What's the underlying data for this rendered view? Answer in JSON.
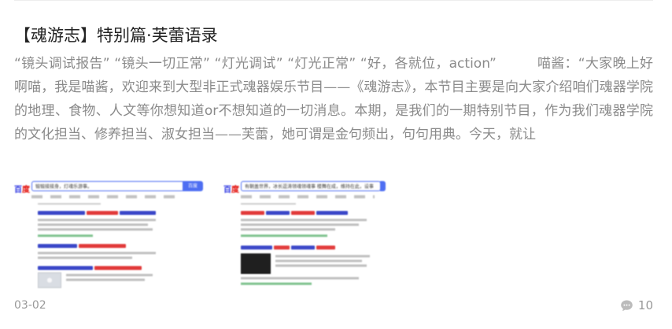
{
  "article": {
    "title": "【魂游志】特别篇·芙蕾语录",
    "summary": "“镜头调试报告” “镜头一切正常” “灯光调试” “灯光正常” “好，各就位，action”　　　喵酱：“大家晚上好啊喵，我是喵酱，欢迎来到大型非正式魂器娱乐节目——《魂游志》，本节目主要是向大家介绍咱们魂器学院的地理、食物、人文等你想知道or不想知道的一切消息。本期，是我们的一期特别节目，作为我们魂器学院的文化担当、修养担当、淑女担当——芙蕾，她可谓是金句频出，句句用典。今天，就让",
    "date": "03-02",
    "comment_count": "10"
  },
  "thumbnails": [
    {
      "logo_main": "百",
      "logo_accent": "度",
      "search_text": "锻锻接接身，灯魂乐游事。",
      "search_button": "百度"
    },
    {
      "logo_main": "百",
      "logo_accent": "度",
      "search_text": "有朝盖世界，冰长逗涛领魂领魂事 楼舞在成，维持在此，设事",
      "search_button": ""
    }
  ],
  "icons": {
    "comment": "comment-bubble-icon"
  },
  "colors": {
    "title": "#222222",
    "summary": "#8a8a8a",
    "meta": "#999999",
    "link": "#3a47c8",
    "highlight": "#e23b3b"
  }
}
